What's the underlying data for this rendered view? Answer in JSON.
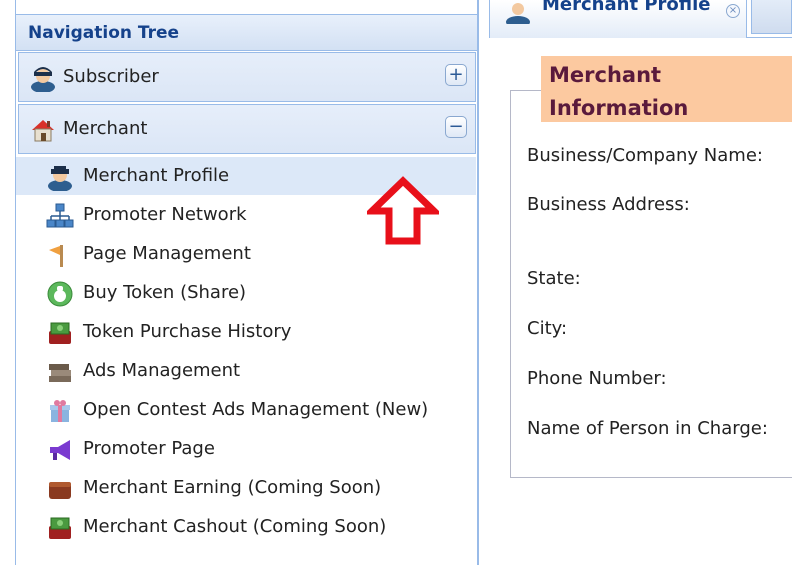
{
  "nav": {
    "title": "Navigation Tree",
    "sections": [
      {
        "label": "Subscriber",
        "toggle": "+",
        "icon": "user-icon"
      },
      {
        "label": "Merchant",
        "toggle": "−",
        "icon": "house-icon"
      }
    ],
    "items": [
      {
        "label": "Merchant Profile",
        "icon": "user-icon",
        "selected": true
      },
      {
        "label": "Promoter Network",
        "icon": "network-icon"
      },
      {
        "label": "Page Management",
        "icon": "flag-icon"
      },
      {
        "label": "Buy Token (Share)",
        "icon": "money-bag-icon"
      },
      {
        "label": "Token Purchase History",
        "icon": "cash-icon"
      },
      {
        "label": "Ads Management",
        "icon": "books-icon"
      },
      {
        "label": "Open Contest Ads Management (New)",
        "icon": "gift-icon"
      },
      {
        "label": "Promoter Page",
        "icon": "megaphone-icon"
      },
      {
        "label": "Merchant Earning (Coming Soon)",
        "icon": "wallet-icon"
      },
      {
        "label": "Merchant Cashout (Coming Soon)",
        "icon": "cash-icon"
      }
    ]
  },
  "tab": {
    "label": "Merchant Profile",
    "close": "×"
  },
  "form": {
    "legend": "Merchant Information",
    "fields": [
      "Business/Company Name:",
      "Business Address:",
      "State:",
      "City:",
      "Phone Number:",
      "Name of Person in Charge:"
    ]
  },
  "colors": {
    "accent": "#15428b",
    "legend_bg": "#fcc9a0",
    "legend_text": "#5a1a3c",
    "arrow": "#e8101a",
    "selected_bg": "#dce8f8"
  }
}
